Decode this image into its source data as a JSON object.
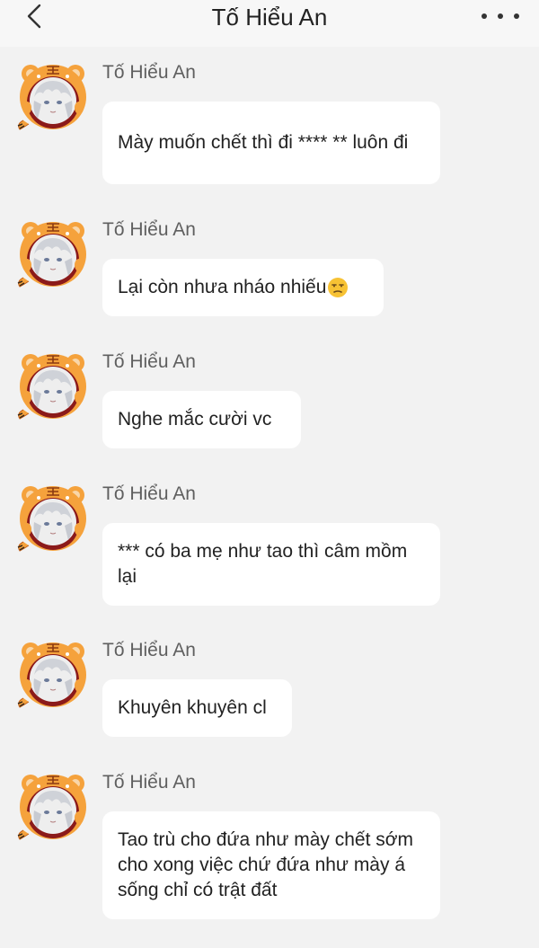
{
  "header": {
    "title": "Tố Hiểu An",
    "back_icon": "chevron-left-icon",
    "more_icon": "more-horizontal-icon"
  },
  "messages": [
    {
      "sender": "Tố Hiểu An",
      "text": "Mày muốn chết thì đi **** ** luôn đi"
    },
    {
      "sender": "Tố Hiểu An",
      "text": "Lại còn nhưa nháo nhiếu",
      "emoji": "unamused-face-emoji"
    },
    {
      "sender": "Tố Hiểu An",
      "text": "Nghe mắc cười vc"
    },
    {
      "sender": "Tố Hiểu An",
      "text": "*** có ba mẹ như tao thì câm mồm lại"
    },
    {
      "sender": "Tố Hiểu An",
      "text": "Khuyên khuyên cl"
    },
    {
      "sender": "Tố Hiểu An",
      "text": "Tao trù cho đứa như mày chết sớm cho xong việc chứ đứa như mày á sống chỉ có trật đất"
    }
  ],
  "colors": {
    "background": "#f2f2f2",
    "bubble": "#ffffff",
    "avatar_tiger": "#f5a23c",
    "avatar_ring": "#8b1a1a"
  }
}
